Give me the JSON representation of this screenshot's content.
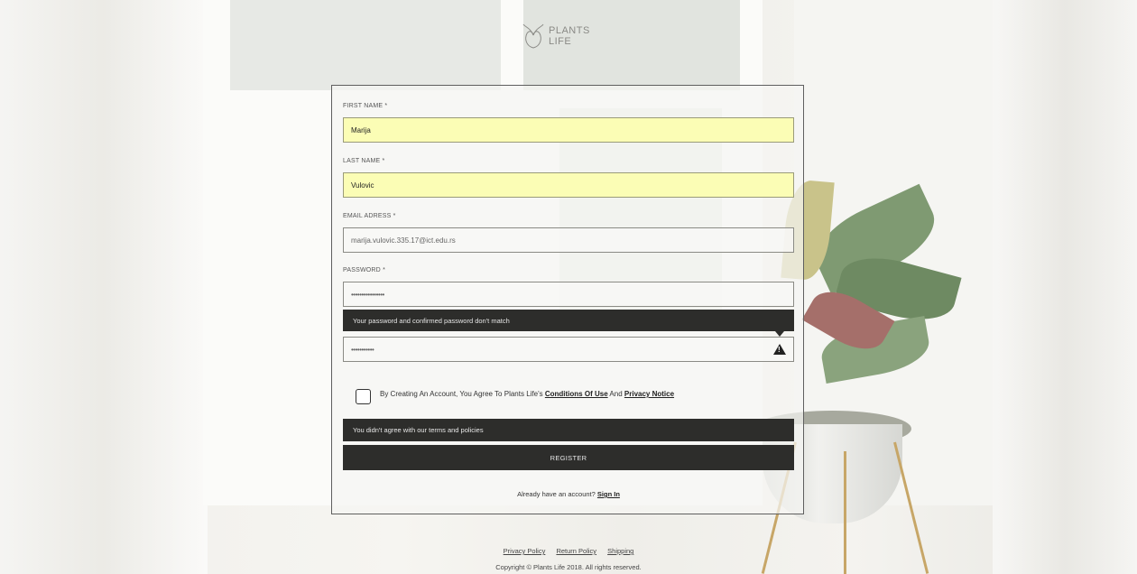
{
  "brand": {
    "line1": "PLANTS",
    "line2": "LIFE"
  },
  "form": {
    "first_name": {
      "label": "FIRST NAME *",
      "value": "Marija"
    },
    "last_name": {
      "label": "LAST NAME *",
      "value": "Vulovic"
    },
    "email": {
      "label": "EMAIL ADRESS *",
      "value": "marija.vulovic.335.17@ict.edu.rs"
    },
    "password": {
      "label": "PASSWORD *",
      "value": "••••••••••••••••"
    },
    "confirm_password": {
      "value": "•••••••••••"
    },
    "password_error": "Your password and confirmed password don't match",
    "terms": {
      "prefix": "By Creating An Account, You Agree To Plants Life's",
      "conditions": "Conditions Of Use",
      "and": "And",
      "privacy": "Privacy Notice"
    },
    "terms_error": "You didn't agree with our terms and policies",
    "register_label": "REGISTER",
    "already_text": "Already have an account?",
    "sign_in_label": "Sign In"
  },
  "footer": {
    "links": [
      "Privacy Policy",
      "Return Policy",
      "Shipping"
    ],
    "copyright": "Copyright © Plants Life 2018. All rights reserved."
  },
  "colors": {
    "filled_field": "#fbfdb5",
    "dark": "#2d2d2b"
  },
  "icons": [
    "plant-logo-icon",
    "warning-icon"
  ]
}
